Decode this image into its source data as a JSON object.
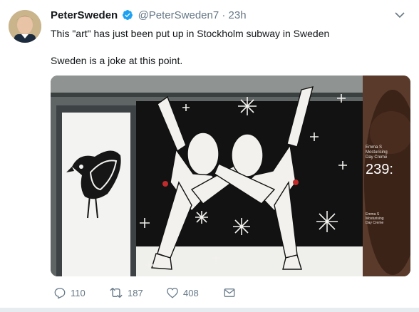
{
  "tweet": {
    "display_name": "PeterSweden",
    "handle": "@PeterSweden7",
    "separator": "·",
    "time": "23h",
    "text_line1": "This \"art\" has just been put up in Stockholm subway in Sweden",
    "text_line2": "Sweden is a joke at this point.",
    "media_overlay": {
      "text_small": "Emma S\nMosturising\nDay Creme",
      "text_big": "239:"
    }
  },
  "actions": {
    "replies": "110",
    "retweets": "187",
    "likes": "408"
  },
  "colors": {
    "verified": "#1da1f2",
    "secondary_text": "#657786",
    "primary_text": "#14171a"
  },
  "icons": [
    "verified-icon",
    "caret-down-icon",
    "reply-icon",
    "retweet-icon",
    "like-icon",
    "message-icon"
  ]
}
